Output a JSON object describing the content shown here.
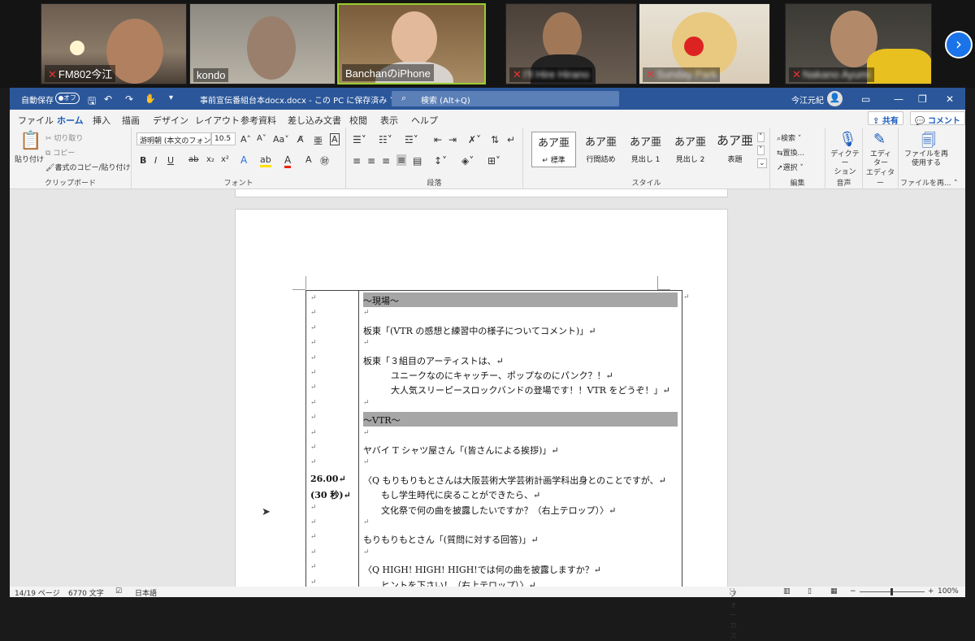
{
  "participants": [
    {
      "name": "FM802今江",
      "muted": true
    },
    {
      "name": "kondo",
      "muted": false
    },
    {
      "name": "BanchanのiPhone",
      "muted": false,
      "active": true
    },
    {
      "name": "I'll Hire Hirano",
      "muted": true
    },
    {
      "name": "Sunday Park",
      "muted": true
    },
    {
      "name": "Nakano Ayumi",
      "muted": true
    }
  ],
  "next_arrow": "›",
  "word": {
    "autosave_label": "自動保存",
    "autosave_state": "オフ",
    "doc_title": "事前宣伝番組台本docx.docx  -  この PC に保存済み  ˅",
    "search_placeholder": "検索 (Alt+Q)",
    "user_name": "今江元紀",
    "tabs": [
      "ファイル",
      "ホーム",
      "挿入",
      "描画",
      "デザイン",
      "レイアウト",
      "参考資料",
      "差し込み文書",
      "校閲",
      "表示",
      "ヘルプ"
    ],
    "share_label": "共有",
    "comment_label": "コメント",
    "clipboard": {
      "paste": "貼り付け",
      "cut": "切り取り",
      "copy": "コピー",
      "format_painter": "書式のコピー/貼り付け",
      "group": "クリップボード"
    },
    "font": {
      "name": "游明朝 (本文のフォン",
      "size": "10.5",
      "group": "フォント"
    },
    "paragraph_group": "段落",
    "styles": [
      {
        "preview": "あア亜",
        "label": "↵ 標準",
        "selected": true
      },
      {
        "preview": "あア亜",
        "label": "行間詰め"
      },
      {
        "preview": "あア亜",
        "label": "見出し 1"
      },
      {
        "preview": "あア亜",
        "label": "見出し 2"
      },
      {
        "preview": "あア亜",
        "label": "表題"
      }
    ],
    "styles_group": "スタイル",
    "editing": {
      "find": "検索",
      "replace": "置換...",
      "select": "選択",
      "group": "編集"
    },
    "voice": {
      "dictate": "ディクテー\nション",
      "group": "音声"
    },
    "editor": {
      "label": "エディ\nター",
      "group": "エディター"
    },
    "reuse": {
      "label": "ファイルを再\n使用する",
      "group": "ファイルを再..."
    },
    "status": {
      "page": "14/19 ページ",
      "words": "6770 文字",
      "lang": "日本語",
      "focus": "フォーカス",
      "zoom": "100%"
    }
  },
  "doc_rows": [
    {
      "left": "↵",
      "right": "～現場～",
      "shaded": true
    },
    {
      "left": "↵",
      "right": "↵"
    },
    {
      "left": "↵",
      "right": "板東「(VTR の感想と練習中の様子についてコメント)」↵"
    },
    {
      "left": "↵",
      "right": "↵"
    },
    {
      "left": "↵",
      "right": "板東「３組目のアーティストは、↵"
    },
    {
      "left": "↵",
      "right": "ユニークなのにキャッチー、ポップなのにパンク？！↵",
      "indent": true
    },
    {
      "left": "↵",
      "right": "大人気スリーピースロックバンドの登場です！！VTR をどうぞ！」↵",
      "indent": true
    },
    {
      "left": "↵",
      "right": "↵"
    },
    {
      "left": "↵",
      "right": "～VTR～",
      "shaded": true
    },
    {
      "left": "↵",
      "right": "↵"
    },
    {
      "left": "↵",
      "right": "ヤバイ T シャツ屋さん「(皆さんによる挨拶)」↵"
    },
    {
      "left": "↵",
      "right": "↵"
    },
    {
      "left": "26.00↵",
      "right": "〈Q もりもりもとさんは大阪芸術大学芸術計画学科出身とのことですが、↵",
      "bold_left": true
    },
    {
      "left": "(30 秒)↵",
      "right": "もし学生時代に戻ることができたら、↵",
      "bold_left": true,
      "indent_small": true
    },
    {
      "left": "↵",
      "right": "文化祭で何の曲を披露したいですか？（右上テロップ）〉↵",
      "indent_small": true
    },
    {
      "left": "↵",
      "right": "↵"
    },
    {
      "left": "↵",
      "right": "もりもりもとさん「(質問に対する回答)」↵"
    },
    {
      "left": "↵",
      "right": "↵"
    },
    {
      "left": "↵",
      "right": "〈Q HIGH! HIGH! HIGH!では何の曲を披露しますか？↵"
    },
    {
      "left": "↵",
      "right": "ヒントを下さい！（右上テロップ）〉↵",
      "indent_small": true
    }
  ]
}
